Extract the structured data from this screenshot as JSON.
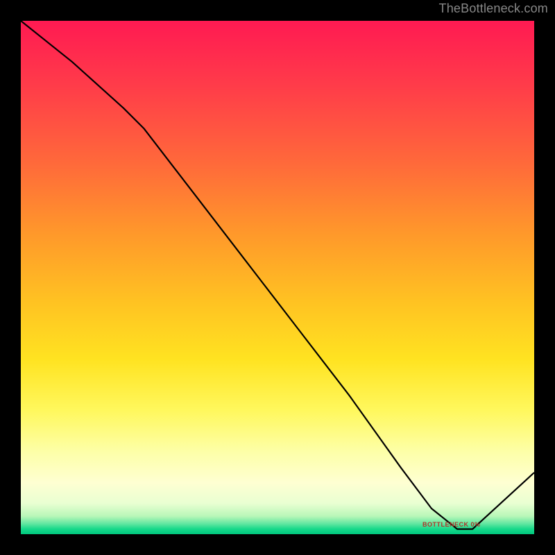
{
  "attribution": "TheBottleneck.com",
  "line_label": "BOTTLENECK 0%",
  "colors": {
    "frame": "#000000",
    "curve": "#000000",
    "label": "#b0352a"
  },
  "chart_data": {
    "type": "line",
    "title": "",
    "xlabel": "",
    "ylabel": "",
    "xlim": [
      0,
      100
    ],
    "ylim": [
      0,
      100
    ],
    "grid": false,
    "series": [
      {
        "name": "bottleneck-curve",
        "x": [
          0,
          10,
          20,
          24,
          34,
          44,
          54,
          64,
          74,
          80,
          85,
          88,
          100
        ],
        "y": [
          100,
          92,
          83,
          79,
          66,
          53,
          40,
          27,
          13,
          5,
          1,
          1,
          12
        ]
      }
    ],
    "annotations": [
      {
        "text": "BOTTLENECK 0%",
        "x": 85,
        "y": 1
      }
    ],
    "gradient_stops": [
      {
        "pos": 0,
        "color": "#ff1a52"
      },
      {
        "pos": 0.28,
        "color": "#ff6a3a"
      },
      {
        "pos": 0.55,
        "color": "#ffc322"
      },
      {
        "pos": 0.76,
        "color": "#fff85e"
      },
      {
        "pos": 0.9,
        "color": "#feffd2"
      },
      {
        "pos": 0.98,
        "color": "#5fe6a0"
      },
      {
        "pos": 1.0,
        "color": "#00c77e"
      }
    ]
  }
}
